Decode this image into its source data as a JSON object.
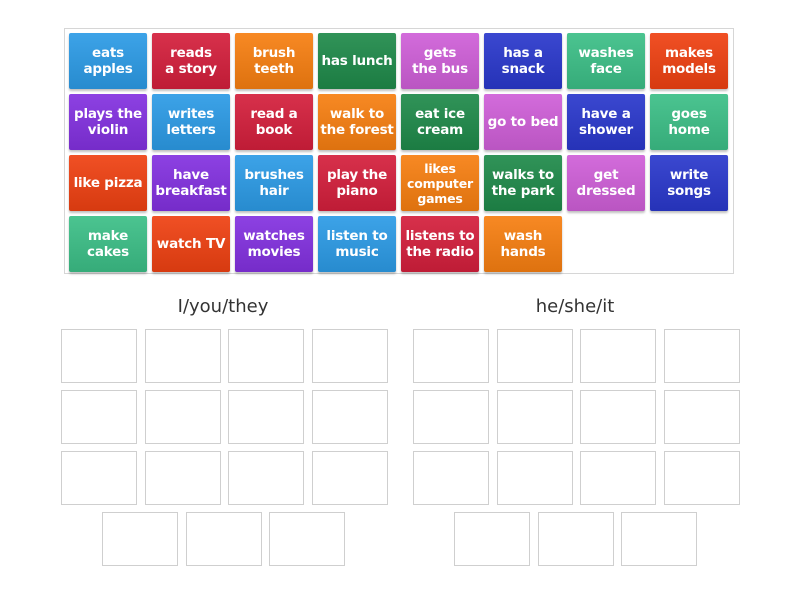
{
  "colors": {
    "blue": "#2c9be6",
    "red": "#d41f3c",
    "orange": "#f77f11",
    "green": "#1f8a4a",
    "purple": "#8331e0",
    "pink": "#cf5fd8",
    "navy": "#2a38cc",
    "teal": "#3cbf87",
    "redorange": "#ef4112"
  },
  "tiles": [
    {
      "label": "eats\napples",
      "color": "blue"
    },
    {
      "label": "reads\na story",
      "color": "red"
    },
    {
      "label": "brush\nteeth",
      "color": "orange"
    },
    {
      "label": "has lunch",
      "color": "green"
    },
    {
      "label": "gets\nthe bus",
      "color": "pink"
    },
    {
      "label": "has a\nsnack",
      "color": "navy"
    },
    {
      "label": "washes\nface",
      "color": "teal"
    },
    {
      "label": "makes\nmodels",
      "color": "redorange"
    },
    {
      "label": "plays the\nviolin",
      "color": "purple"
    },
    {
      "label": "writes\nletters",
      "color": "blue"
    },
    {
      "label": "read a\nbook",
      "color": "red"
    },
    {
      "label": "walk to\nthe forest",
      "color": "orange"
    },
    {
      "label": "eat ice\ncream",
      "color": "green"
    },
    {
      "label": "go to bed",
      "color": "pink"
    },
    {
      "label": "have a\nshower",
      "color": "navy"
    },
    {
      "label": "goes\nhome",
      "color": "teal"
    },
    {
      "label": "like pizza",
      "color": "redorange"
    },
    {
      "label": "have\nbreakfast",
      "color": "purple"
    },
    {
      "label": "brushes\nhair",
      "color": "blue"
    },
    {
      "label": "play the\npiano",
      "color": "red"
    },
    {
      "label": "likes\ncomputer\ngames",
      "color": "orange"
    },
    {
      "label": "walks to\nthe park",
      "color": "green"
    },
    {
      "label": "get\ndressed",
      "color": "pink"
    },
    {
      "label": "write\nsongs",
      "color": "navy"
    },
    {
      "label": "make\ncakes",
      "color": "teal"
    },
    {
      "label": "watch TV",
      "color": "redorange"
    },
    {
      "label": "watches\nmovies",
      "color": "purple"
    },
    {
      "label": "listen to\nmusic",
      "color": "blue"
    },
    {
      "label": "listens to\nthe radio",
      "color": "red"
    },
    {
      "label": "wash\nhands",
      "color": "orange"
    }
  ],
  "groups": [
    {
      "title": "I/you/they",
      "slots": 15
    },
    {
      "title": "he/she/it",
      "slots": 15
    }
  ]
}
